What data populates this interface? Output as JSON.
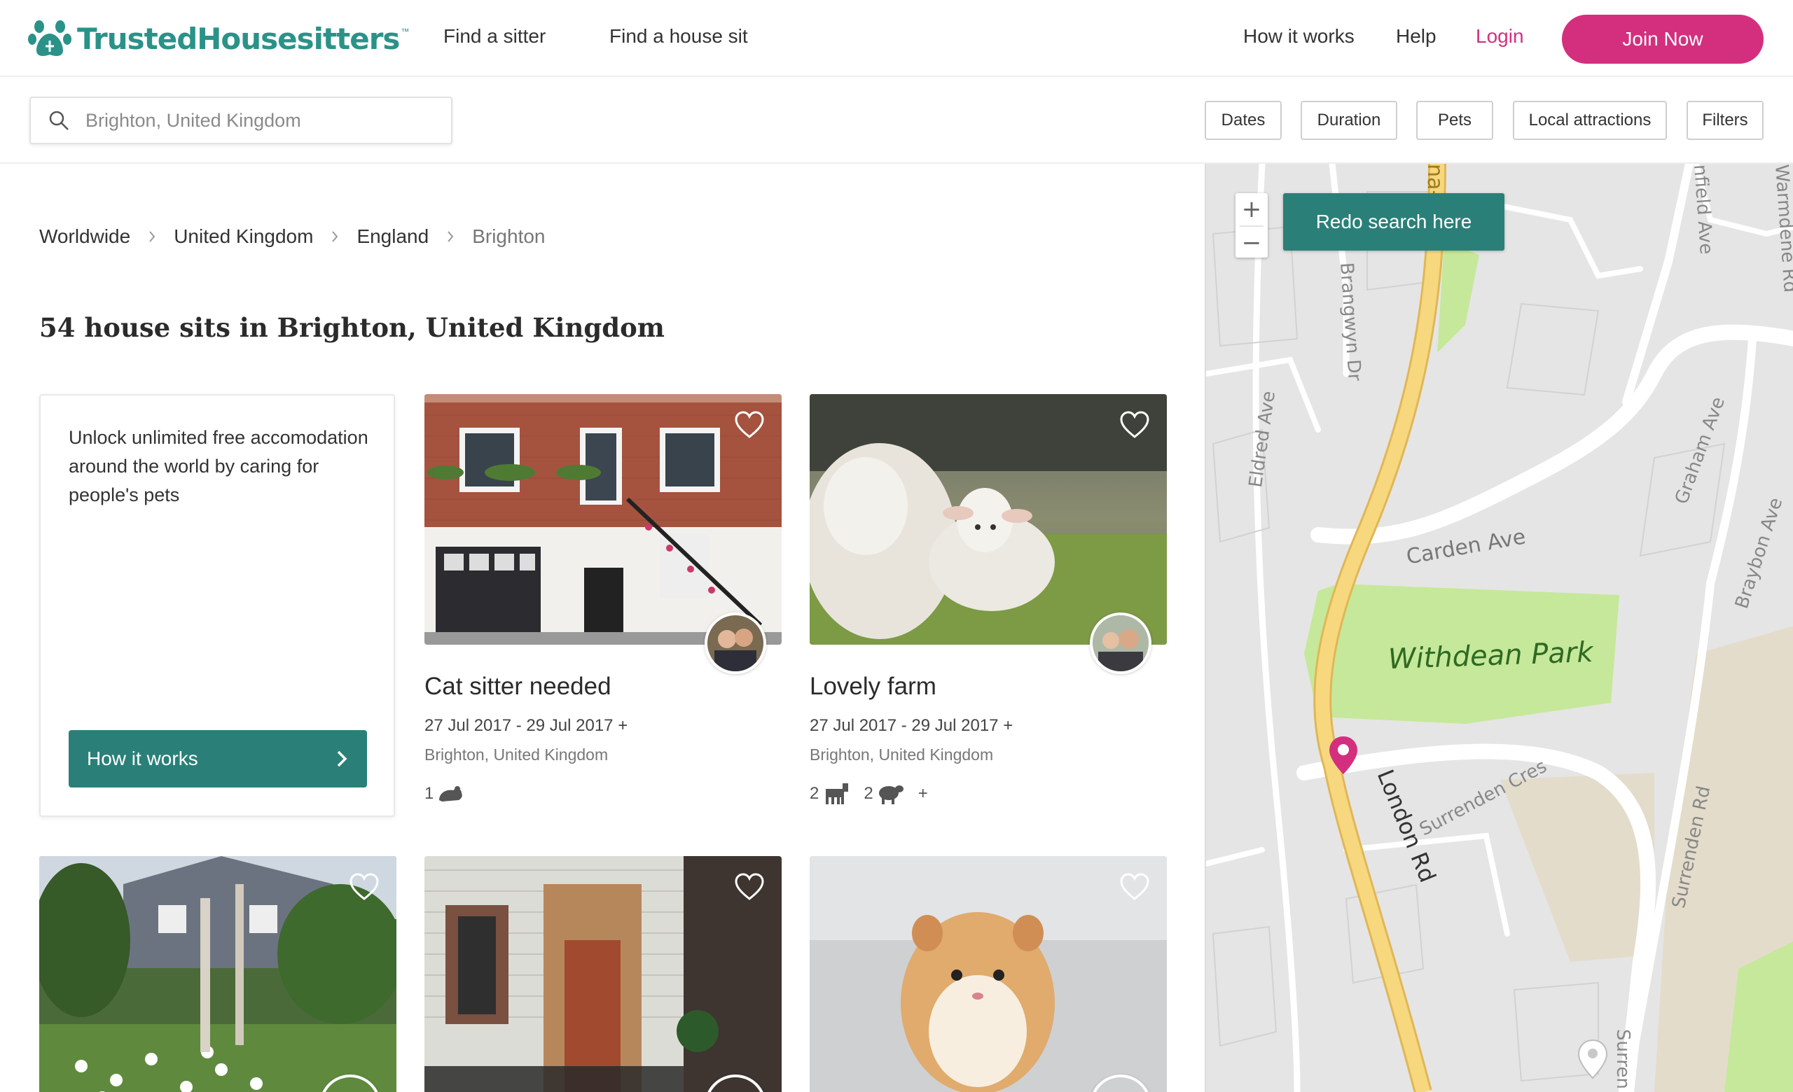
{
  "header": {
    "brand": "TrustedHousesitters",
    "brand_tm": "™",
    "nav_left": [
      "Find a sitter",
      "Find a house sit"
    ],
    "nav_right": [
      "How it works",
      "Help"
    ],
    "login": "Login",
    "join": "Join Now"
  },
  "search": {
    "placeholder": "Brighton, United Kingdom",
    "filters": [
      "Dates",
      "Duration",
      "Pets",
      "Local attractions",
      "Filters"
    ]
  },
  "breadcrumb": [
    "Worldwide",
    "United Kingdom",
    "England",
    "Brighton"
  ],
  "results_title": "54 house sits in Brighton, United Kingdom",
  "promo": {
    "text": "Unlock unlimited free accomodation around the world by caring for people's pets",
    "button": "How it works"
  },
  "listings": [
    {
      "title": "Cat sitter needed",
      "dates": "27 Jul 2017 - 29 Jul 2017 +",
      "location": "Brighton, United Kingdom",
      "pets": [
        {
          "count": "1",
          "icon": "rodent-icon"
        }
      ],
      "extra": ""
    },
    {
      "title": "Lovely farm",
      "dates": "27 Jul 2017 - 29 Jul 2017 +",
      "location": "Brighton, United Kingdom",
      "pets": [
        {
          "count": "2",
          "icon": "farm-animal-icon"
        },
        {
          "count": "2",
          "icon": "sheep-icon"
        }
      ],
      "extra": "+"
    }
  ],
  "map": {
    "redo_button": "Redo search here",
    "zoom_in": "+",
    "zoom_out": "−",
    "labels": {
      "park": "Withdean Park",
      "london_rd": "London Rd",
      "carden_ave": "Carden Ave",
      "surrenden_cres": "Surrenden Cres",
      "surrenden_rd": "Surrenden Rd",
      "surrenden_rd_2": "Surren",
      "bypass": "na-Pass",
      "brangwyn_dr": "Brangwyn Dr",
      "eldred_ave": "Eldred Ave",
      "graham_ave": "Graham Ave",
      "braybon_ave": "Braybon Ave",
      "infield_ave": "nfield Ave",
      "warmdene_rd": "Warmdene Rd"
    }
  },
  "colors": {
    "brand_teal": "#2a9289",
    "button_teal": "#2a8078",
    "pink": "#d42f7f"
  }
}
